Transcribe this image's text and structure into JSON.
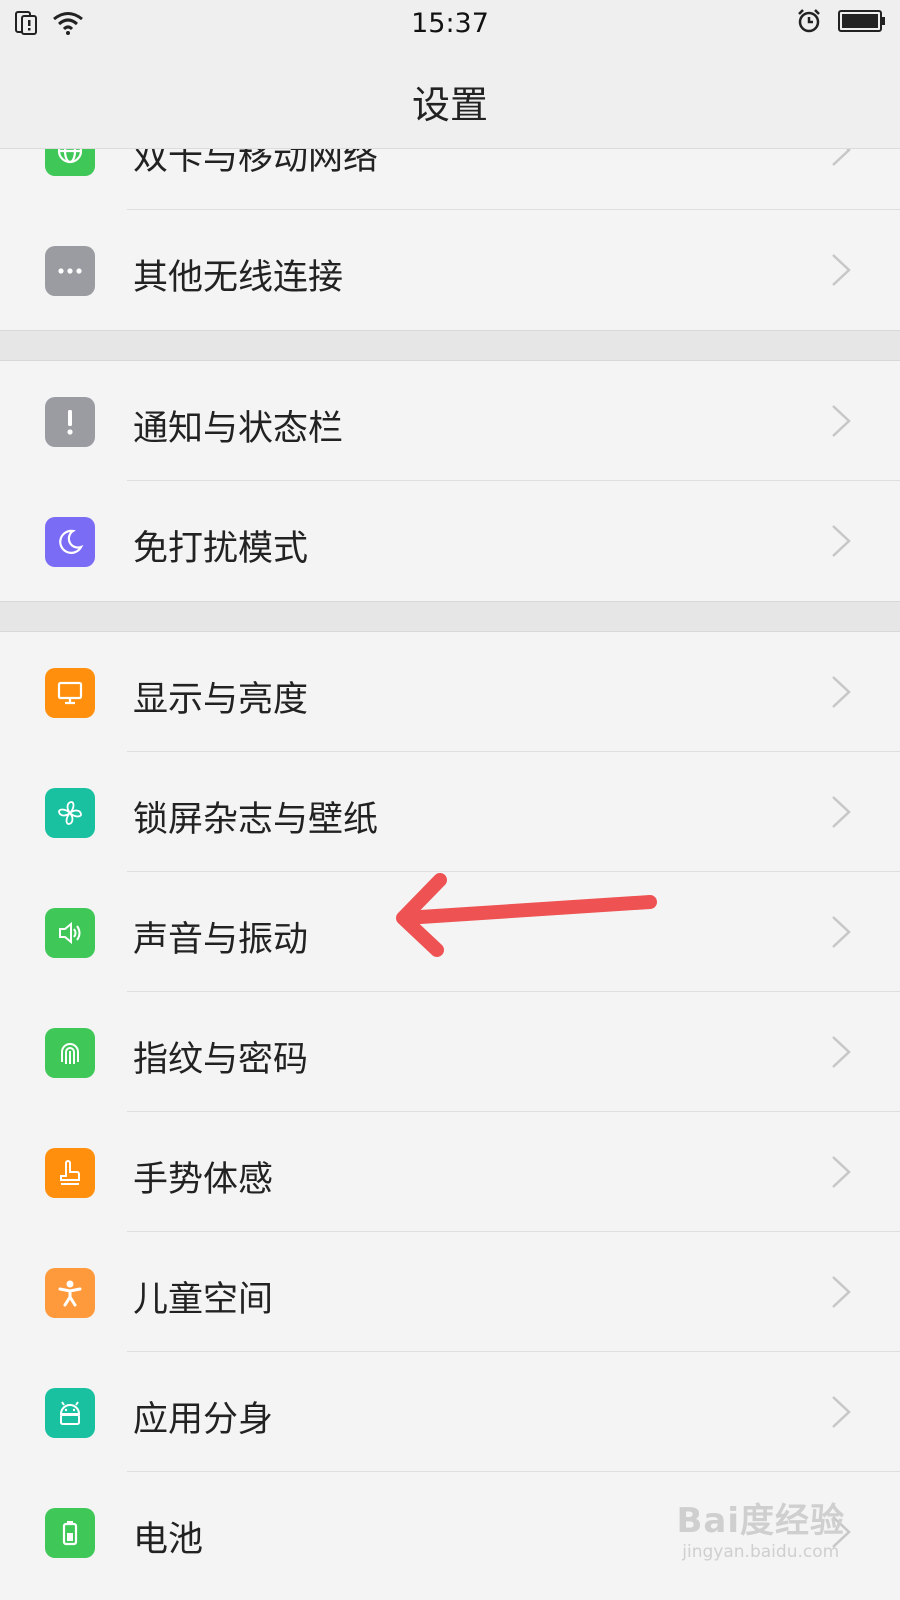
{
  "status_bar": {
    "time": "15:37"
  },
  "header": {
    "title": "设置"
  },
  "colors": {
    "red_arrow": "#ee5252",
    "green": "#3fc758",
    "gray": "#9a9ca1",
    "purple": "#7b6cf5",
    "orange": "#ff8f0c",
    "teal": "#19c1a0",
    "light_orange": "#ff9a3c"
  },
  "settings": {
    "g1": [
      {
        "label": "双卡与移动网络",
        "icon": "globe-icon",
        "color": "#3fc758"
      },
      {
        "label": "其他无线连接",
        "icon": "more-dots-icon",
        "color": "#9a9ca1"
      }
    ],
    "g2": [
      {
        "label": "通知与状态栏",
        "icon": "notification-icon",
        "color": "#9a9ca1"
      },
      {
        "label": "免打扰模式",
        "icon": "moon-icon",
        "color": "#7b6cf5"
      }
    ],
    "g3": [
      {
        "label": "显示与亮度",
        "icon": "display-icon",
        "color": "#ff8f0c"
      },
      {
        "label": "锁屏杂志与壁纸",
        "icon": "pinwheel-icon",
        "color": "#19c1a0"
      },
      {
        "label": "声音与振动",
        "icon": "speaker-icon",
        "color": "#3fc758"
      },
      {
        "label": "指纹与密码",
        "icon": "fingerprint-icon",
        "color": "#3fc758"
      },
      {
        "label": "手势体感",
        "icon": "gesture-hand-icon",
        "color": "#ff8f0c"
      },
      {
        "label": "儿童空间",
        "icon": "child-icon",
        "color": "#ff9a3c"
      },
      {
        "label": "应用分身",
        "icon": "android-clone-icon",
        "color": "#19c1a0"
      },
      {
        "label": "电池",
        "icon": "battery-icon",
        "color": "#3fc758"
      }
    ]
  },
  "watermark": {
    "main": "Bai度经验",
    "sub": "jingyan.baidu.com"
  }
}
